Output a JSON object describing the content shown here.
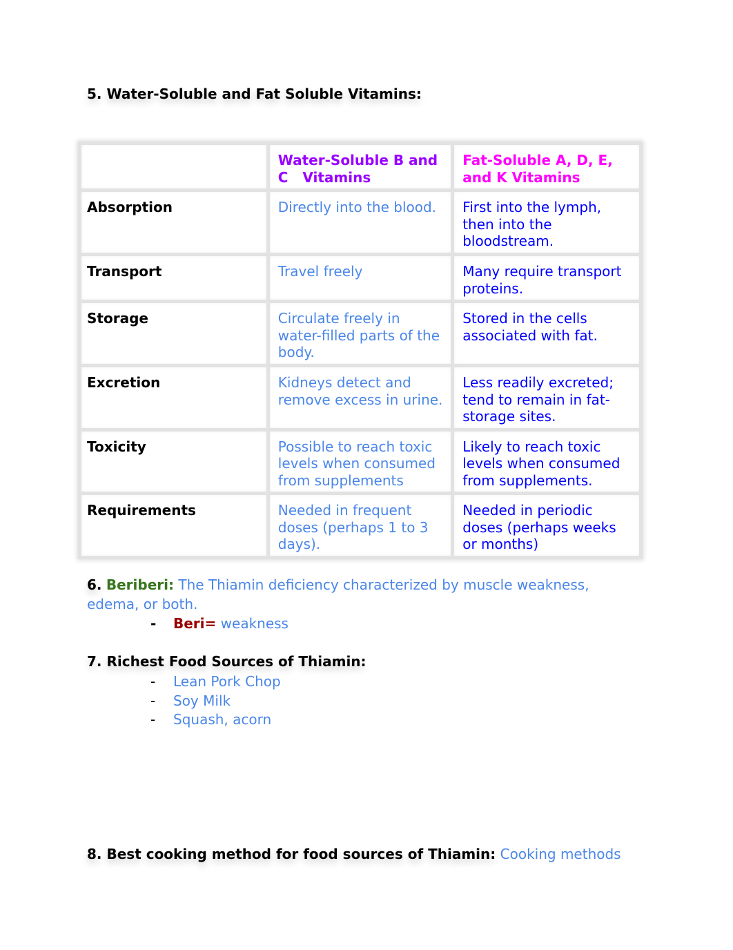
{
  "section5": {
    "title": "5. Water-Soluble and Fat Soluble Vitamins:",
    "table": {
      "headers": [
        "",
        "Water-Soluble B and C   Vitamins",
        "Fat-Soluble A, D, E, and K Vitamins"
      ],
      "rows": [
        {
          "label": "Absorption",
          "water": "Directly into the blood.",
          "fat": "First into the lymph, then into the bloodstream."
        },
        {
          "label": "Transport",
          "water": "Travel freely",
          "fat": "Many require transport proteins."
        },
        {
          "label": "Storage",
          "water": "Circulate freely in water-filled parts of the body.",
          "fat": "Stored in the cells associated with fat."
        },
        {
          "label": "Excretion",
          "water": "Kidneys detect and remove excess in urine.",
          "fat": "Less readily excreted; tend to remain in fat-storage sites."
        },
        {
          "label": "Toxicity",
          "water": "Possible to reach toxic levels when consumed from supplements",
          "fat": "Likely to reach toxic levels when consumed from supplements."
        },
        {
          "label": "Requirements",
          "water": "Needed in frequent doses (perhaps 1 to 3 days).",
          "fat": "Needed in periodic doses (perhaps weeks or months)"
        }
      ]
    }
  },
  "section6": {
    "number": "6.",
    "term": "Beriberi:",
    "definition": "The Thiamin deficiency characterized by muscle weakness, edema, or both.",
    "bullet": {
      "dash": "-",
      "term": "Beri=",
      "meaning": "weakness"
    }
  },
  "section7": {
    "title": "7. Richest Food Sources of Thiamin:",
    "items": [
      {
        "dash": "-",
        "text": "Lean Pork Chop"
      },
      {
        "dash": "-",
        "text": "Soy Milk"
      },
      {
        "dash": "-",
        "text": "Squash, acorn"
      }
    ]
  },
  "section8": {
    "title": "8. Best cooking method for food sources of Thiamin:",
    "answer": "Cooking methods"
  },
  "colors": {
    "heading": "#000000",
    "water_header": "#9900ff",
    "fat_header": "#ff00ff",
    "water_text": "#4a86e8",
    "fat_text": "#0000ff",
    "beriberi_term": "#38761d",
    "beri_term": "#990000"
  }
}
